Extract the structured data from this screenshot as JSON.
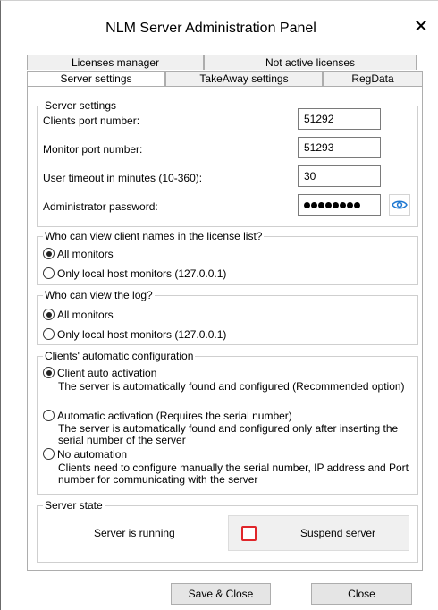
{
  "window": {
    "title": "NLM Server Administration Panel"
  },
  "tabs": {
    "row1": [
      "Licenses manager",
      "Not active licenses"
    ],
    "row2": [
      "Server settings",
      "TakeAway settings",
      "RegData"
    ]
  },
  "server_settings": {
    "legend": "Server settings",
    "clients_port_label": "Clients port number:",
    "clients_port_value": "51292",
    "monitor_port_label": "Monitor port number:",
    "monitor_port_value": "51293",
    "timeout_label": "User timeout in minutes (10-360):",
    "timeout_value": "30",
    "password_label": "Administrator password:"
  },
  "view_names": {
    "legend": "Who can view client names in the license list?",
    "opt_all": "All monitors",
    "opt_local": "Only local host monitors (127.0.0.1)",
    "selected": "all"
  },
  "view_log": {
    "legend": "Who can view the log?",
    "opt_all": "All monitors",
    "opt_local": "Only local host monitors (127.0.0.1)",
    "selected": "all"
  },
  "auto_config": {
    "legend": "Clients' automatic configuration",
    "opt1": "Client auto activation",
    "opt1_desc": "The server is automatically found and configured (Recommended option)",
    "opt2": "Automatic activation (Requires the serial number)",
    "opt2_desc_1": "The server is automatically found and configured only after inserting the",
    "opt2_desc_2": "serial number of the server",
    "opt3": "No automation",
    "opt3_desc_1": "Clients need to configure manually the serial number, IP address and Port",
    "opt3_desc_2": "number for communicating with the server",
    "selected": "opt1"
  },
  "server_state": {
    "legend": "Server state",
    "status": "Server is running",
    "suspend_label": "Suspend server"
  },
  "footer": {
    "save_label": "Save & Close",
    "close_label": "Close"
  },
  "colors": {
    "suspend_icon": "#e0262a",
    "eye_icon": "#1e78d2"
  }
}
